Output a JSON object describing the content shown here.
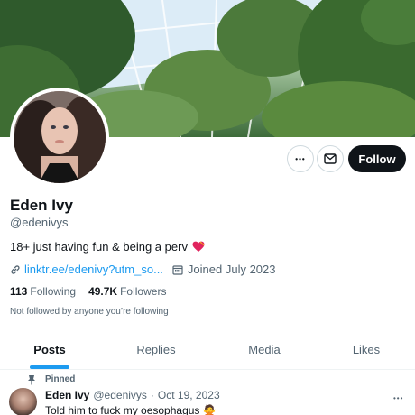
{
  "profile": {
    "display_name": "Eden Ivy",
    "handle": "@edenivys",
    "bio": "18+ just having fun & being a perv",
    "link_text": "linktr.ee/edenivy?utm_so...",
    "joined": "Joined July 2023",
    "following_count": "113",
    "following_label": "Following",
    "followers_count": "49.7K",
    "followers_label": "Followers",
    "follow_note": "Not followed by anyone you’re following"
  },
  "actions": {
    "more_label": "•••",
    "follow_label": "Follow"
  },
  "tabs": [
    "Posts",
    "Replies",
    "Media",
    "Likes"
  ],
  "pinned_tweet": {
    "pinned_label": "Pinned",
    "name": "Eden Ivy",
    "handle": "@edenivys",
    "separator": "·",
    "date": "Oct 19, 2023",
    "more_label": "•••",
    "text": "Told him to fuck my oesophagus 🙅"
  },
  "colors": {
    "accent": "#1d9bf0",
    "text_primary": "#0f1419",
    "text_secondary": "#536471",
    "follow_button_bg": "#0f1419"
  },
  "icons": {
    "bio_emoji": "heart-icon",
    "link": "link-icon",
    "joined": "calendar-icon",
    "message": "mail-icon",
    "pin": "pin-icon"
  }
}
